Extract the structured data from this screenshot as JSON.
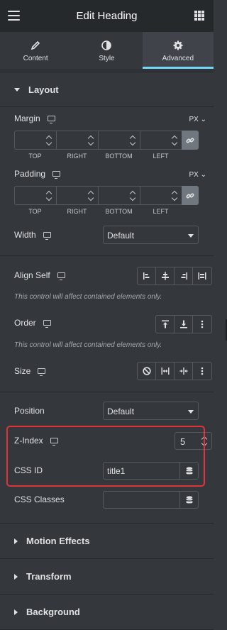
{
  "header": {
    "title": "Edit Heading",
    "menu_icon": "hamburger-icon",
    "grid_icon": "grid-icon"
  },
  "tabs": [
    {
      "label": "Content",
      "icon": "pencil-icon",
      "active": false
    },
    {
      "label": "Style",
      "icon": "half-circle-icon",
      "active": false
    },
    {
      "label": "Advanced",
      "icon": "gear-icon",
      "active": true
    }
  ],
  "layout": {
    "section_title": "Layout",
    "margin": {
      "label": "Margin",
      "unit": "PX",
      "sublabels": [
        "TOP",
        "RIGHT",
        "BOTTOM",
        "LEFT"
      ]
    },
    "padding": {
      "label": "Padding",
      "unit": "PX",
      "sublabels": [
        "TOP",
        "RIGHT",
        "BOTTOM",
        "LEFT"
      ]
    },
    "width": {
      "label": "Width",
      "value": "Default"
    },
    "align_self": {
      "label": "Align Self",
      "note": "This control will affect contained elements only."
    },
    "order": {
      "label": "Order",
      "note": "This control will affect contained elements only."
    },
    "size": {
      "label": "Size"
    },
    "position": {
      "label": "Position",
      "value": "Default"
    },
    "z_index": {
      "label": "Z-Index",
      "value": "5"
    },
    "css_id": {
      "label": "CSS ID",
      "value": "title1"
    },
    "css_classes": {
      "label": "CSS Classes",
      "value": ""
    }
  },
  "sections": [
    "Motion Effects",
    "Transform",
    "Background"
  ],
  "colors": {
    "accent": "#71d7f7",
    "highlight": "#e0343a",
    "panel": "#34383c",
    "header": "#26292c"
  }
}
